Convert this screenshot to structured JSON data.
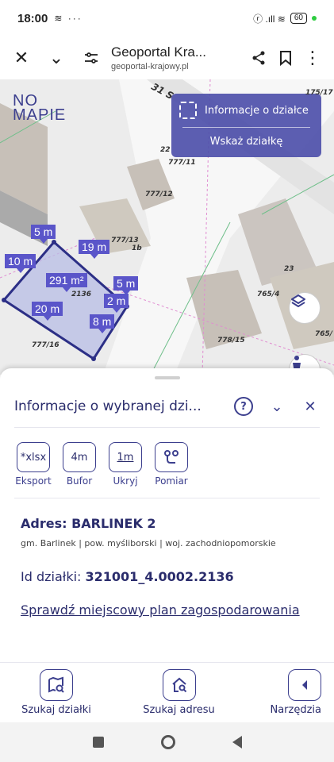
{
  "status_bar": {
    "time": "18:00",
    "left_icons": "≋ ···",
    "battery": "60",
    "signal": "ⓡ .ıll ≋"
  },
  "browser": {
    "title": "Geoportal Kra...",
    "url": "geoportal-krajowy.pl"
  },
  "map": {
    "logo_line1": "NO",
    "logo_line2": "MAPIE",
    "street": "31 S",
    "info_panel": {
      "parcel_info": "Informacje o działce",
      "show_parcel": "Wskaż działkę"
    },
    "measurements": [
      "5 m",
      "19 m",
      "10 m",
      "291 m²",
      "5 m",
      "2 m",
      "20 m",
      "8 m"
    ],
    "parcel_labels": [
      "175/17",
      "22",
      "777/11",
      "777/12",
      "777/13",
      "1b",
      "2136",
      "23",
      "765/4",
      "778/15",
      "765/",
      "777/16"
    ]
  },
  "panel": {
    "title": "Informacje o wybranej dzi...",
    "tools": [
      {
        "icon": "*xlsx",
        "label": "Eksport"
      },
      {
        "icon": "4m",
        "label": "Bufor"
      },
      {
        "icon": "1m",
        "label": "Ukryj"
      },
      {
        "icon": "route-icon",
        "label": "Pomiar"
      }
    ],
    "address_title": "Adres: BARLINEK 2",
    "address_sub": "gm. Barlinek | pow. myśliborski | woj. zachodniopomorskie",
    "parcel_id_label": "Id działki:",
    "parcel_id_value": "321001_4.0002.2136",
    "plan_link": "Sprawdź miejscowy plan zagospodarowania"
  },
  "bottom_nav": [
    {
      "label": "Szukaj działki",
      "icon": "map-search-icon"
    },
    {
      "label": "Szukaj adresu",
      "icon": "home-search-icon"
    },
    {
      "label": "Narzędzia",
      "icon": "chevron-left-icon"
    }
  ],
  "colors": {
    "accent": "#3c3f8e",
    "parcel_fill": "#b8bde6",
    "label_bg": "#5a55c9"
  }
}
